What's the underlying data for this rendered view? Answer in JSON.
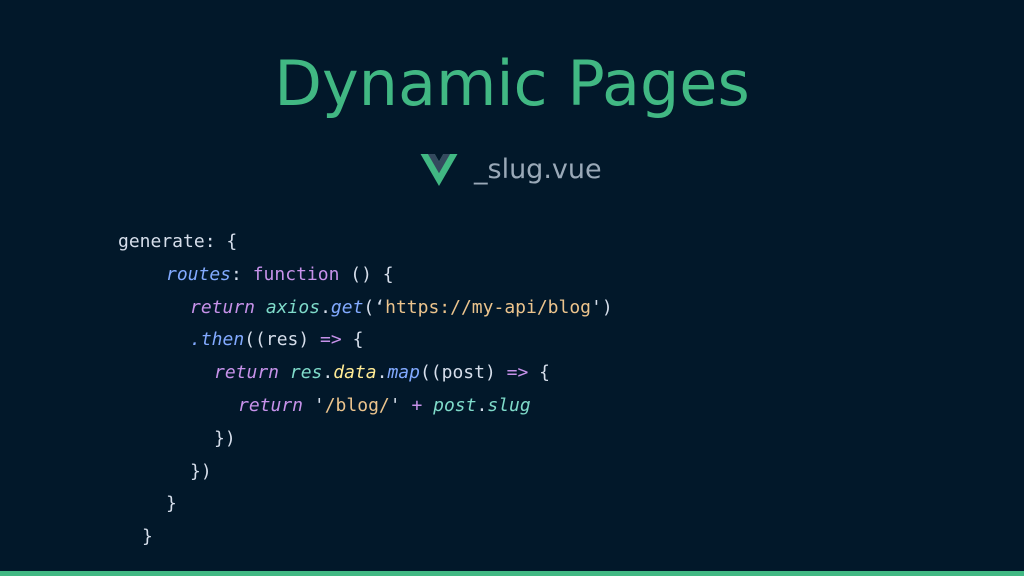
{
  "slide": {
    "title": "Dynamic Pages",
    "file_label": "_slug.vue",
    "icon": "vue-logo-icon"
  },
  "colors": {
    "background": "#02182a",
    "accent": "#41b883",
    "vue_dark": "#34495e"
  },
  "code": {
    "lines": [
      [
        {
          "text": "generate: {",
          "cls": "tok-plain"
        }
      ],
      [
        {
          "text": "  ",
          "cls": "tok-plain"
        },
        {
          "text": "routes",
          "cls": "tok-prop"
        },
        {
          "text": ": ",
          "cls": "tok-plain"
        },
        {
          "text": "function",
          "cls": "tok-keyword"
        },
        {
          "text": " () {",
          "cls": "tok-plain"
        }
      ],
      [
        {
          "text": "    ",
          "cls": "tok-plain"
        },
        {
          "text": "return",
          "cls": "tok-ret"
        },
        {
          "text": " ",
          "cls": "tok-plain"
        },
        {
          "text": "axios",
          "cls": "tok-ident"
        },
        {
          "text": ".",
          "cls": "tok-plain"
        },
        {
          "text": "get",
          "cls": "tok-method"
        },
        {
          "text": "(‘",
          "cls": "tok-plain"
        },
        {
          "text": "https://my-api/blog",
          "cls": "tok-string"
        },
        {
          "text": "')",
          "cls": "tok-plain"
        }
      ],
      [
        {
          "text": "    ",
          "cls": "tok-plain"
        },
        {
          "text": ".then",
          "cls": "tok-method"
        },
        {
          "text": "((res) ",
          "cls": "tok-plain"
        },
        {
          "text": "=>",
          "cls": "tok-arrow"
        },
        {
          "text": " {",
          "cls": "tok-plain"
        }
      ],
      [
        {
          "text": "      ",
          "cls": "tok-plain"
        },
        {
          "text": "return",
          "cls": "tok-ret"
        },
        {
          "text": " ",
          "cls": "tok-plain"
        },
        {
          "text": "res",
          "cls": "tok-ident"
        },
        {
          "text": ".",
          "cls": "tok-plain"
        },
        {
          "text": "data",
          "cls": "tok-prop2"
        },
        {
          "text": ".",
          "cls": "tok-plain"
        },
        {
          "text": "map",
          "cls": "tok-method"
        },
        {
          "text": "((post) ",
          "cls": "tok-plain"
        },
        {
          "text": "=>",
          "cls": "tok-arrow"
        },
        {
          "text": " {",
          "cls": "tok-plain"
        }
      ],
      [
        {
          "text": "        ",
          "cls": "tok-plain"
        },
        {
          "text": "return",
          "cls": "tok-ret"
        },
        {
          "text": " '",
          "cls": "tok-plain"
        },
        {
          "text": "/blog/",
          "cls": "tok-string"
        },
        {
          "text": "' ",
          "cls": "tok-plain"
        },
        {
          "text": "+",
          "cls": "tok-arrow"
        },
        {
          "text": " ",
          "cls": "tok-plain"
        },
        {
          "text": "post",
          "cls": "tok-ident"
        },
        {
          "text": ".",
          "cls": "tok-plain"
        },
        {
          "text": "slug",
          "cls": "tok-ident"
        }
      ],
      [
        {
          "text": "      })",
          "cls": "tok-plain"
        }
      ],
      [
        {
          "text": "    })",
          "cls": "tok-plain"
        }
      ],
      [
        {
          "text": "  }",
          "cls": "tok-plain"
        }
      ],
      [
        {
          "text": "}",
          "cls": "tok-plain"
        }
      ]
    ]
  }
}
